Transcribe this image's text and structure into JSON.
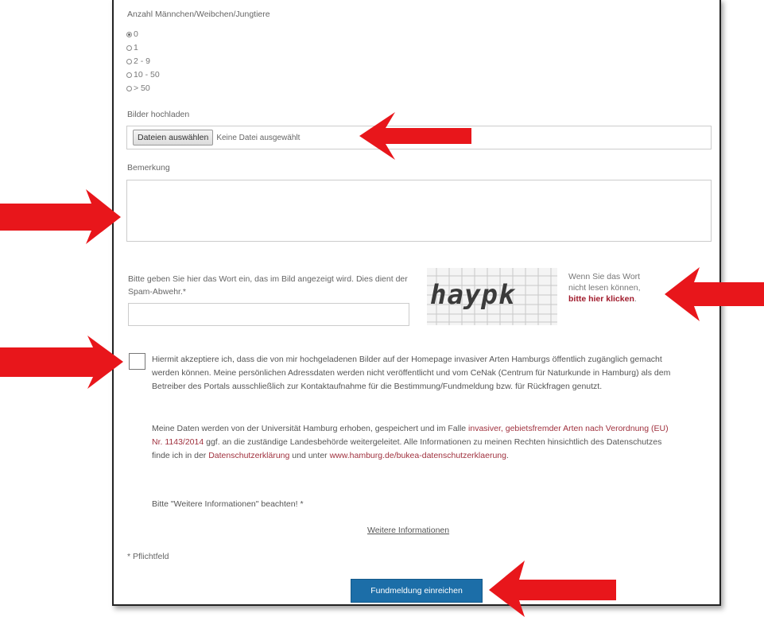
{
  "form": {
    "count_label": "Anzahl Männchen/Weibchen/Jungtiere",
    "count_options": [
      "0",
      "1",
      "2 - 9",
      "10 - 50",
      "> 50"
    ],
    "count_selected": "0",
    "upload_label": "Bilder hochladen",
    "upload_button": "Dateien auswählen",
    "upload_status": "Keine Datei ausgewählt",
    "remark_label": "Bemerkung",
    "spam_text": "Bitte geben Sie hier das Wort ein, das im Bild angezeigt wird. Dies dient der Spam-Abwehr.*",
    "captcha_word": "haypk",
    "captcha_hint": "Wenn Sie das Wort nicht lesen können,",
    "captcha_link": "bitte hier klicken",
    "consent_p1": "Hiermit akzeptiere ich, dass die von mir hochgeladenen Bilder auf der Homepage invasiver Arten Hamburgs öffentlich zugänglich gemacht werden können. Meine persönlichen Adressdaten werden nicht veröffentlicht und vom CeNak (Centrum für Naturkunde in Hamburg) als dem Betreiber des Portals ausschließlich zur Kontaktaufnahme für die Bestimmung/Fundmeldung bzw. für Rückfragen genutzt.",
    "consent_p2_a": "Meine Daten werden von der Universität Hamburg erhoben, gespeichert und im Falle",
    "consent_p2_link1": "invasiver, gebietsfremder Arten nach Verordnung (EU) Nr. 1143/2014",
    "consent_p2_b": "ggf. an die zuständige Landesbehörde weitergeleitet. Alle Informationen zu meinen Rechten hinsichtlich des Datenschutzes finde ich in der",
    "consent_p2_link2": "Datenschutzerklärung",
    "consent_p2_c": "und unter",
    "consent_p2_link3": "www.hamburg.de/bukea-datenschutzerklaerung",
    "consent_p2_end": ".",
    "consent_p3": "Bitte \"Weitere Informationen\" beachten! *",
    "more_info": "Weitere Informationen",
    "required_note": "* Pflichtfeld",
    "submit": "Fundmeldung einreichen"
  },
  "colors": {
    "arrow": "#e8161b",
    "submit_bg": "#1c6ea8",
    "link": "#a0323f"
  }
}
